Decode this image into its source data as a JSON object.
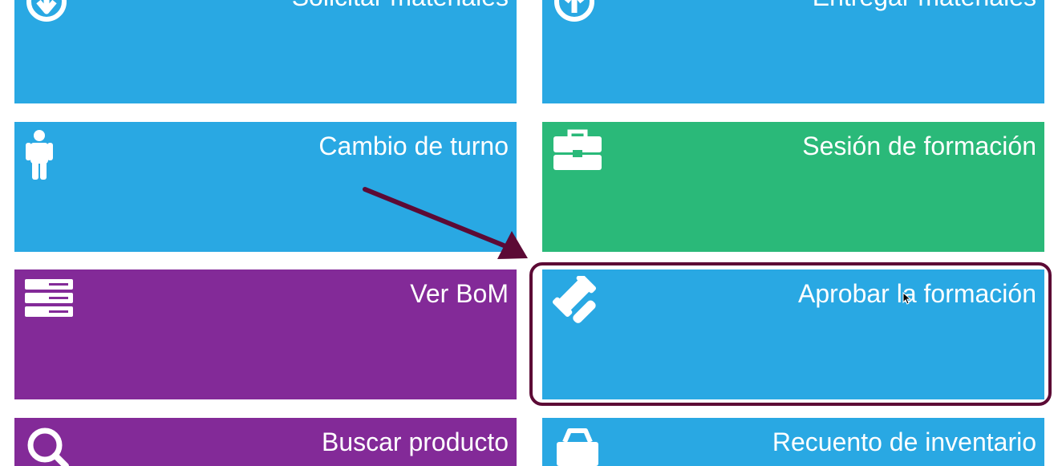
{
  "colors": {
    "blue": "#29a8e3",
    "green": "#2ab979",
    "purple": "#832a98",
    "highlight": "#5c0a35"
  },
  "tiles": [
    {
      "label": "Solicitar materiales",
      "icon": "arrow-down-circle-icon",
      "color": "blue"
    },
    {
      "label": "Entregar materiales",
      "icon": "arrow-up-circle-icon",
      "color": "blue"
    },
    {
      "label": "Cambio de turno",
      "icon": "person-icon",
      "color": "blue"
    },
    {
      "label": "Sesión de formación",
      "icon": "briefcase-icon",
      "color": "green"
    },
    {
      "label": "Ver BoM",
      "icon": "server-stack-icon",
      "color": "purple"
    },
    {
      "label": "Aprobar la formación",
      "icon": "gavel-icon",
      "color": "blue"
    },
    {
      "label": "Buscar producto",
      "icon": "search-icon",
      "color": "purple"
    },
    {
      "label": "Recuento de inventario",
      "icon": "inventory-cart-icon",
      "color": "blue"
    }
  ],
  "annotation": {
    "highlighted_tile": "Aprobar la formación",
    "arrow": "pointer-arrow"
  }
}
